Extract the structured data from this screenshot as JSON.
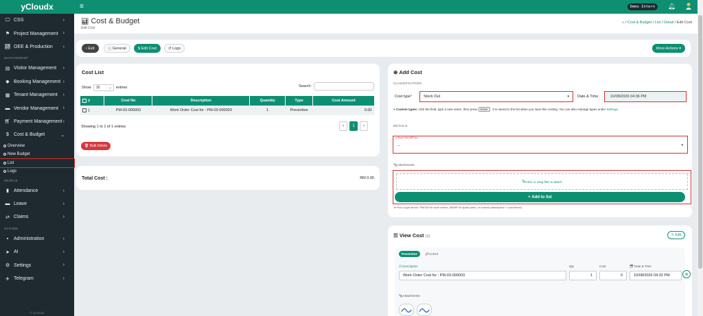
{
  "app": {
    "brand": "yCloudx",
    "user_badge": "Demo Intern",
    "footer": "© yCloudx"
  },
  "sidebar": {
    "top_items": [
      {
        "label": "CSS",
        "icon": "monitor-icon"
      },
      {
        "label": "Project Management",
        "icon": "flag-icon"
      },
      {
        "label": "OEE & Production",
        "icon": "chart-line-icon"
      }
    ],
    "section_management": "MANAGEMENT",
    "management_items": [
      {
        "label": "Visitor Management",
        "icon": "id-card-icon"
      },
      {
        "label": "Booking Management",
        "icon": "diamond-icon"
      },
      {
        "label": "Tenant Management",
        "icon": "building-icon"
      },
      {
        "label": "Vendor Management",
        "icon": "truck-icon"
      },
      {
        "label": "Payment Management",
        "icon": "cart-icon"
      },
      {
        "label": "Cost & Budget",
        "icon": "dollar-icon"
      }
    ],
    "cost_sub": [
      "Overview",
      "New Budget",
      "List",
      "Logs"
    ],
    "section_people": "PEOPLE",
    "people_items": [
      {
        "label": "Attendance",
        "icon": "clipboard-icon"
      },
      {
        "label": "Leave",
        "icon": "bed-icon"
      },
      {
        "label": "Claims",
        "icon": "exchange-icon"
      }
    ],
    "section_system": "SYSTEM",
    "system_items": [
      {
        "label": "Administration",
        "icon": "admin-icon"
      },
      {
        "label": "AI",
        "icon": "send-icon"
      },
      {
        "label": "Settings",
        "icon": "gear-icon"
      },
      {
        "label": "Telegram",
        "icon": "telegram-icon"
      }
    ]
  },
  "header": {
    "title": "Cost & Budget",
    "subtitle": "Edit Cost",
    "breadcrumbs": [
      "Cost & Budget",
      "List",
      "Detail",
      "Edit Cost"
    ]
  },
  "toolbar": {
    "exit": "Exit",
    "general": "General",
    "edit_cost": "Edit Cost",
    "logs": "Logs",
    "more_actions": "More Actions"
  },
  "cost_list": {
    "title": "Cost List",
    "show_label": "Show",
    "show_value": "15",
    "entries_label": "entries",
    "search_label": "Search:",
    "columns": [
      "#",
      "Cost No",
      "Description",
      "Quantity",
      "Type",
      "Cost Amount"
    ],
    "rows": [
      {
        "idx": "1",
        "cost_no": "PM-03-000003",
        "description": "Work Order Cost for : PM-03-000003",
        "quantity": "1",
        "type": "Preventive",
        "amount": "0.00"
      }
    ],
    "info": "Showing 1 to 1 of 1 entries",
    "page": "1",
    "bulk_delete": "Bulk Delete"
  },
  "total": {
    "label": "Total Cost :",
    "value": "RM 0.00"
  },
  "add_cost": {
    "title": "Add Cost",
    "classification": "CLASSIFICATION",
    "cost_type_label": "Cost type",
    "cost_type_value": "Stock Out",
    "date_label": "Date & Time",
    "date_value": "10/08/2026 04:36 PM",
    "help_strong": "Custom types:",
    "help_text": "click the field, type a new name, then press",
    "help_key": "Enter",
    "help_text2": ". It is saved to the list when you save this costing. You can also manage types under",
    "help_link": "Settings",
    "details": "DETAILS",
    "details_field_label": "Stock Out (MR No)",
    "details_value": "--",
    "attachments": "Attachments",
    "drop_text": "Click or drag files to attach",
    "add_button": "Add to list",
    "hint": "Pick a type above: PM/CM for work orders, MI/MR for spare parts, or custom (description + cost below)."
  },
  "view_cost": {
    "title": "View Cost",
    "count": "(1)",
    "edit": "Edit",
    "tag": "Preventive",
    "linked": "Linked",
    "col_description": "Description",
    "col_qty": "Qty",
    "col_cost": "Cost",
    "col_date": "Date & Time",
    "description": "Work Order Cost for : PM-03-000003",
    "qty": "1",
    "cost": "0",
    "date": "10/08/2026 04:32 PM",
    "attachments": "Attachments"
  }
}
